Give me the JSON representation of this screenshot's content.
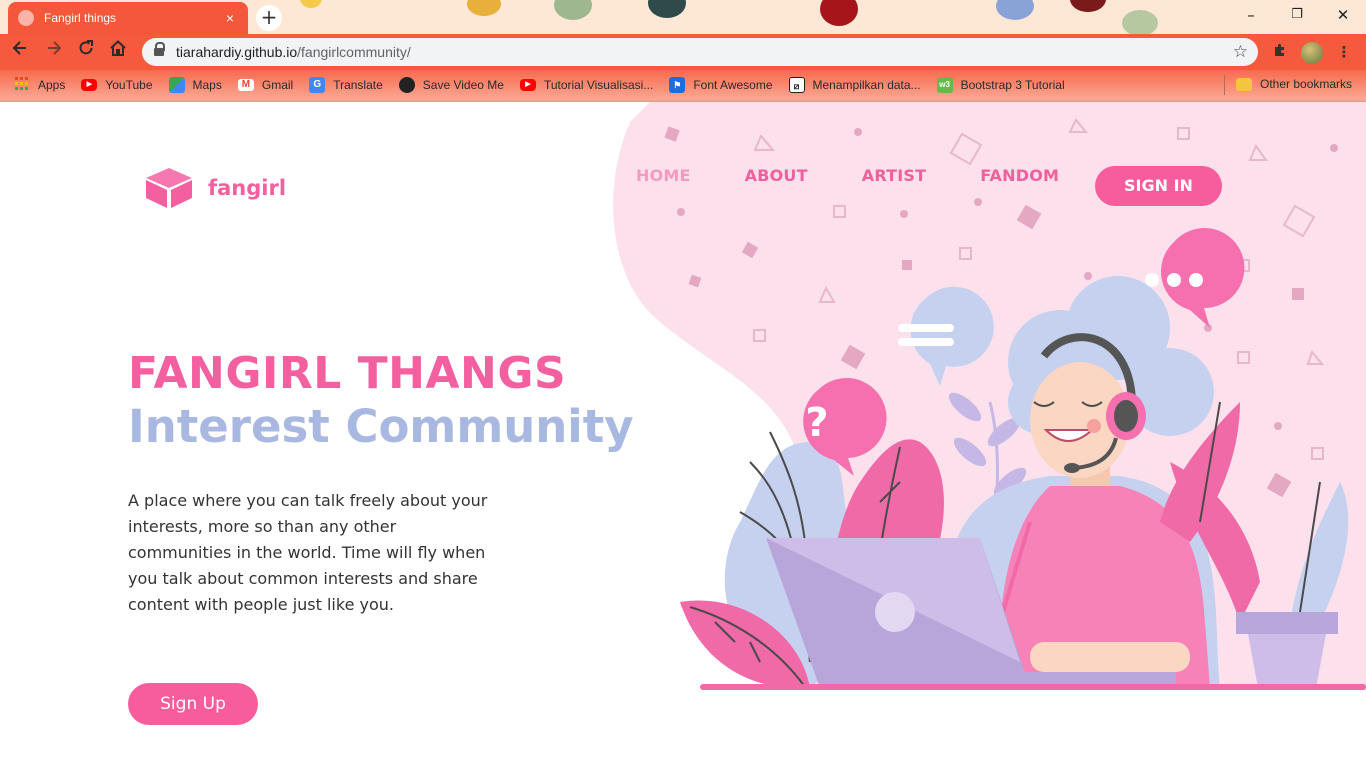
{
  "browser": {
    "tab_title": "Fangirl things",
    "tab_close": "×",
    "new_tab": "+",
    "url_host": "tiarahardiy.github.io",
    "url_path": "/fangirlcommunity/",
    "icons": [
      "back-icon",
      "forward-icon",
      "reload-icon",
      "home-icon",
      "lock-icon",
      "star-icon",
      "extensions-icon",
      "minimize-icon",
      "restore-icon",
      "close-icon"
    ],
    "window_controls": {
      "minimize": "–",
      "restore": "❐",
      "close": "✕"
    }
  },
  "bookmarks": {
    "items": [
      {
        "label": "Apps",
        "icon": "apps-grid-icon",
        "color": "#e64a19"
      },
      {
        "label": "YouTube",
        "icon": "youtube-icon",
        "color": "#ff0000"
      },
      {
        "label": "Maps",
        "icon": "maps-icon",
        "color": "#34a853"
      },
      {
        "label": "Gmail",
        "icon": "gmail-icon",
        "color": "#ea4335"
      },
      {
        "label": "Translate",
        "icon": "translate-icon",
        "color": "#4285f4"
      },
      {
        "label": "Save Video Me",
        "icon": "globe-icon",
        "color": "#222222"
      },
      {
        "label": "Tutorial Visualisasi...",
        "icon": "youtube-icon",
        "color": "#ff0000"
      },
      {
        "label": "Font Awesome",
        "icon": "flag-icon",
        "color": "#1c6de0"
      },
      {
        "label": "Menampilkan data...",
        "icon": "bookmark-site-icon",
        "color": "#222222"
      },
      {
        "label": "Bootstrap 3 Tutorial",
        "icon": "w3-icon",
        "color": "#6ab84a"
      }
    ],
    "other": "Other bookmarks"
  },
  "site": {
    "logo_text": "fangirl",
    "nav": [
      {
        "label": "HOME",
        "active": true
      },
      {
        "label": "ABOUT",
        "active": false
      },
      {
        "label": "ARTIST",
        "active": false
      },
      {
        "label": "FANDOM",
        "active": false
      }
    ],
    "signin": "SIGN IN",
    "hero_title": "FANGIRL THANGS",
    "hero_subtitle": "Interest Community",
    "hero_description": "A place where you can talk freely about your interests, more so than any other communities in the world. Time will fly when you talk about common interests and share content with people just like you.",
    "signup": "Sign Up",
    "question_mark": "?"
  },
  "colors": {
    "brand_pink": "#f4609f",
    "button_pink": "#f75c9c",
    "subtitle_blue": "#a8b8e0",
    "blob_pink": "#fce1ec",
    "chrome_orange": "#f65a3c"
  }
}
